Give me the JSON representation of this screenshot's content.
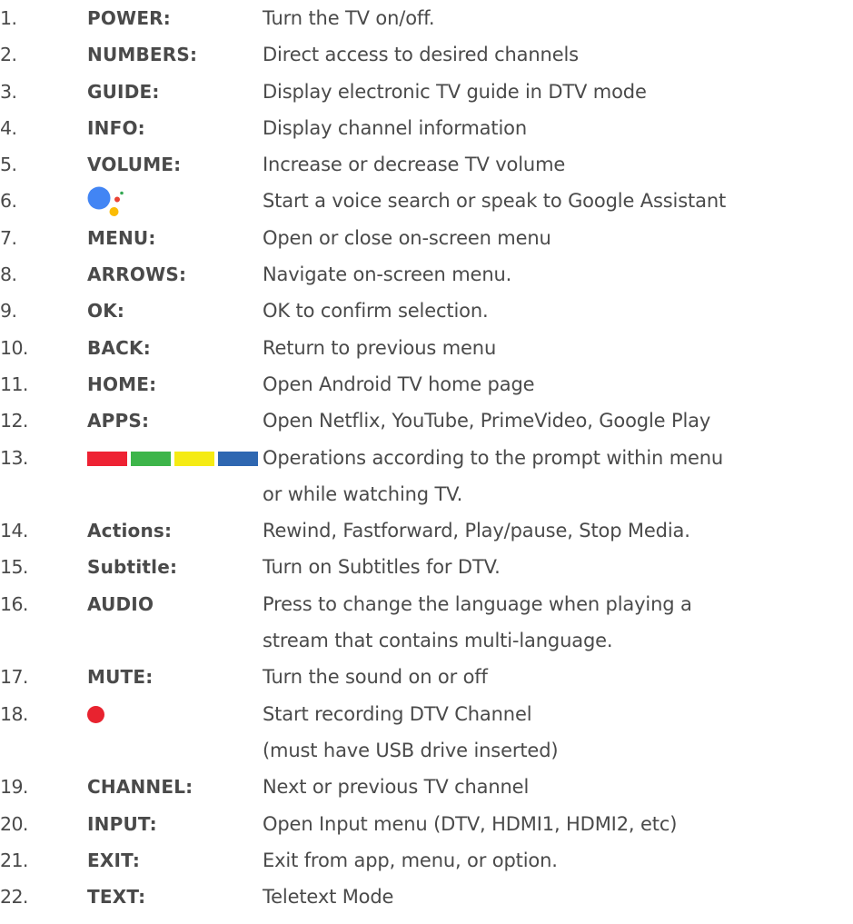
{
  "colors": {
    "text": "#4a4a4a",
    "ga_blue": "#4285F4",
    "ga_red": "#EA4335",
    "ga_yellow": "#FBBC05",
    "ga_green": "#34A853",
    "key_red": "#EE2233",
    "key_green": "#3DB54A",
    "key_yellow": "#F5EB14",
    "key_blue": "#2E67B1",
    "record_red": "#E8232F"
  },
  "items": [
    {
      "num": "1.",
      "key": "POWER:",
      "desc": [
        "Turn the TV on/off."
      ]
    },
    {
      "num": "2.",
      "key": "NUMBERS:",
      "desc": [
        "Direct access to desired channels"
      ]
    },
    {
      "num": "3.",
      "key": "GUIDE:",
      "desc": [
        "Display electronic TV guide in DTV mode"
      ]
    },
    {
      "num": "4.",
      "key": "INFO:",
      "desc": [
        "Display channel information"
      ]
    },
    {
      "num": "5.",
      "key": "VOLUME:",
      "desc": [
        "Increase or decrease TV volume"
      ]
    },
    {
      "num": "6.",
      "icon": "google-assistant-icon",
      "desc": [
        "Start a voice search or speak to Google Assistant"
      ]
    },
    {
      "num": "7.",
      "key": "MENU:",
      "desc": [
        "Open or close on-screen menu"
      ]
    },
    {
      "num": "8.",
      "key": "ARROWS:",
      "desc": [
        "Navigate on-screen menu."
      ]
    },
    {
      "num": "9.",
      "key": "OK:",
      "desc": [
        "OK to confirm selection."
      ]
    },
    {
      "num": "10.",
      "key": "BACK:",
      "desc": [
        "Return to previous menu"
      ]
    },
    {
      "num": "11.",
      "key": "HOME:",
      "desc": [
        "Open Android TV home page"
      ]
    },
    {
      "num": "12.",
      "key": "APPS:",
      "desc": [
        "Open Netflix, YouTube, PrimeVideo, Google Play"
      ]
    },
    {
      "num": "13.",
      "icon": "color-keys-icon",
      "desc": [
        "Operations according to the prompt within menu",
        "or while watching TV."
      ]
    },
    {
      "num": "14.",
      "key": "Actions:",
      "desc": [
        "Rewind, Fastforward, Play/pause, Stop Media."
      ]
    },
    {
      "num": "15.",
      "key": "Subtitle:",
      "desc": [
        "Turn on Subtitles for DTV."
      ]
    },
    {
      "num": "16.",
      "key": "AUDIO",
      "desc": [
        "Press to change the language when playing a",
        "stream that contains multi-language."
      ]
    },
    {
      "num": "17.",
      "key": "MUTE:",
      "desc": [
        "Turn the sound on or off"
      ]
    },
    {
      "num": "18.",
      "icon": "record-dot-icon",
      "desc": [
        "Start recording DTV Channel",
        "(must have USB drive inserted)"
      ]
    },
    {
      "num": "19.",
      "key": "CHANNEL:",
      "desc": [
        "Next or previous TV channel"
      ]
    },
    {
      "num": "20.",
      "key": "INPUT:",
      "desc": [
        "Open Input menu (DTV, HDMI1, HDMI2, etc)"
      ]
    },
    {
      "num": "21.",
      "key": "EXIT:",
      "desc": [
        "Exit from app, menu, or option."
      ]
    },
    {
      "num": "22.",
      "key": "TEXT:",
      "desc": [
        "Teletext Mode"
      ]
    }
  ]
}
